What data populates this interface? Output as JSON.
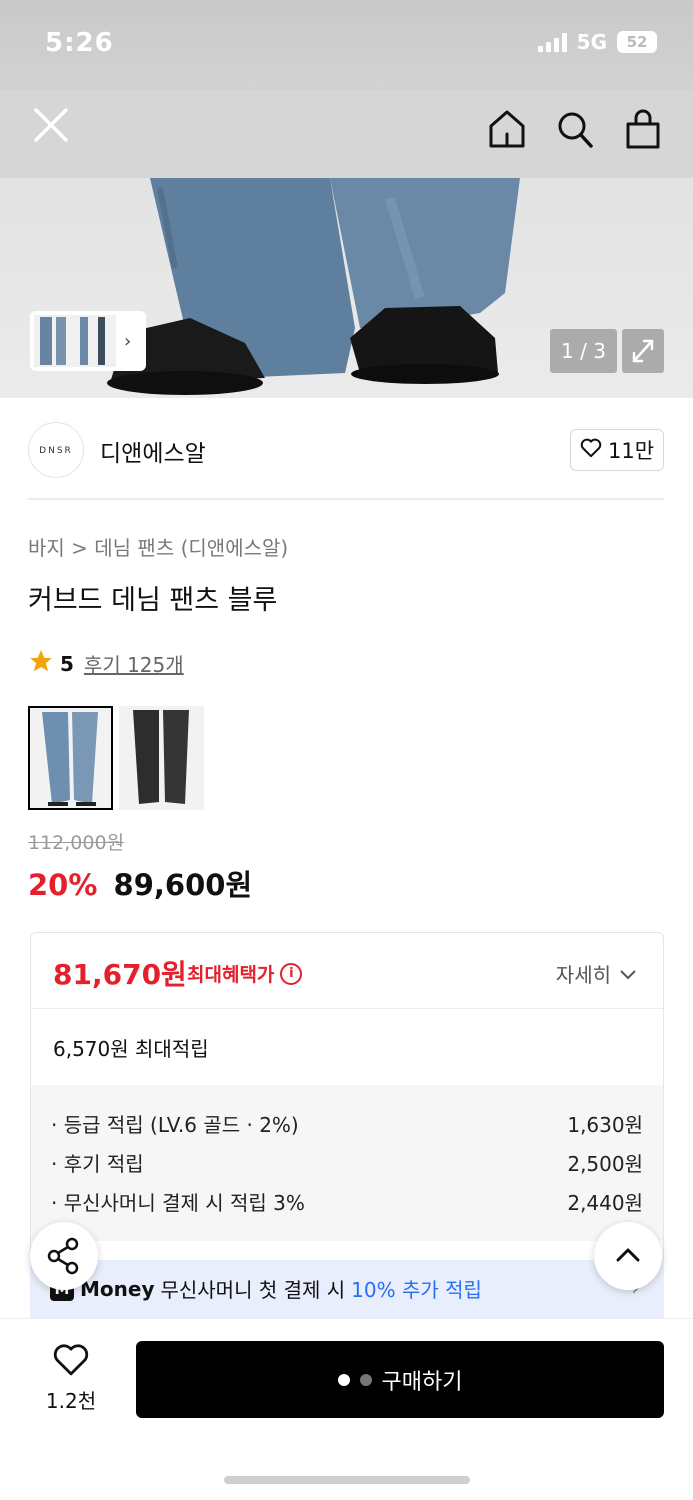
{
  "status": {
    "time": "5:26",
    "network": "5G",
    "battery": "52"
  },
  "nav": {
    "close": "close",
    "home": "home",
    "search": "search",
    "bag": "shopping-bag"
  },
  "hero": {
    "pager": "1 / 3"
  },
  "brand": {
    "logo_text": "DNSR",
    "name": "디앤에스알",
    "likes": "11만"
  },
  "breadcrumb": "바지 > 데님 팬츠 (디앤에스알)",
  "product": {
    "title": "커브드 데님 팬츠 블루",
    "rating": "5",
    "reviews": "후기 125개",
    "original_price": "112,000원",
    "discount": "20%",
    "price": "89,600원"
  },
  "benefit": {
    "max_price": "81,670원",
    "max_label": "최대혜택가",
    "info_glyph": "i",
    "detail": "자세히",
    "points_head": "6,570원 최대적립",
    "points": [
      {
        "label": "· 등급 적립 (LV.6 골드 · 2%)",
        "amount": "1,630원"
      },
      {
        "label": "· 후기 적립",
        "amount": "2,500원"
      },
      {
        "label": "· 무신사머니 결제 시 적립 3%",
        "amount": "2,440원"
      }
    ]
  },
  "money": {
    "logo": "M",
    "word": "Money",
    "text": "무신사머니 첫 결제 시",
    "accent": "10% 추가 적립"
  },
  "bottom": {
    "wish_count": "1.2천",
    "buy": "구매하기"
  },
  "colors": {
    "accent": "#e5202c",
    "link": "#2a6ff0"
  }
}
